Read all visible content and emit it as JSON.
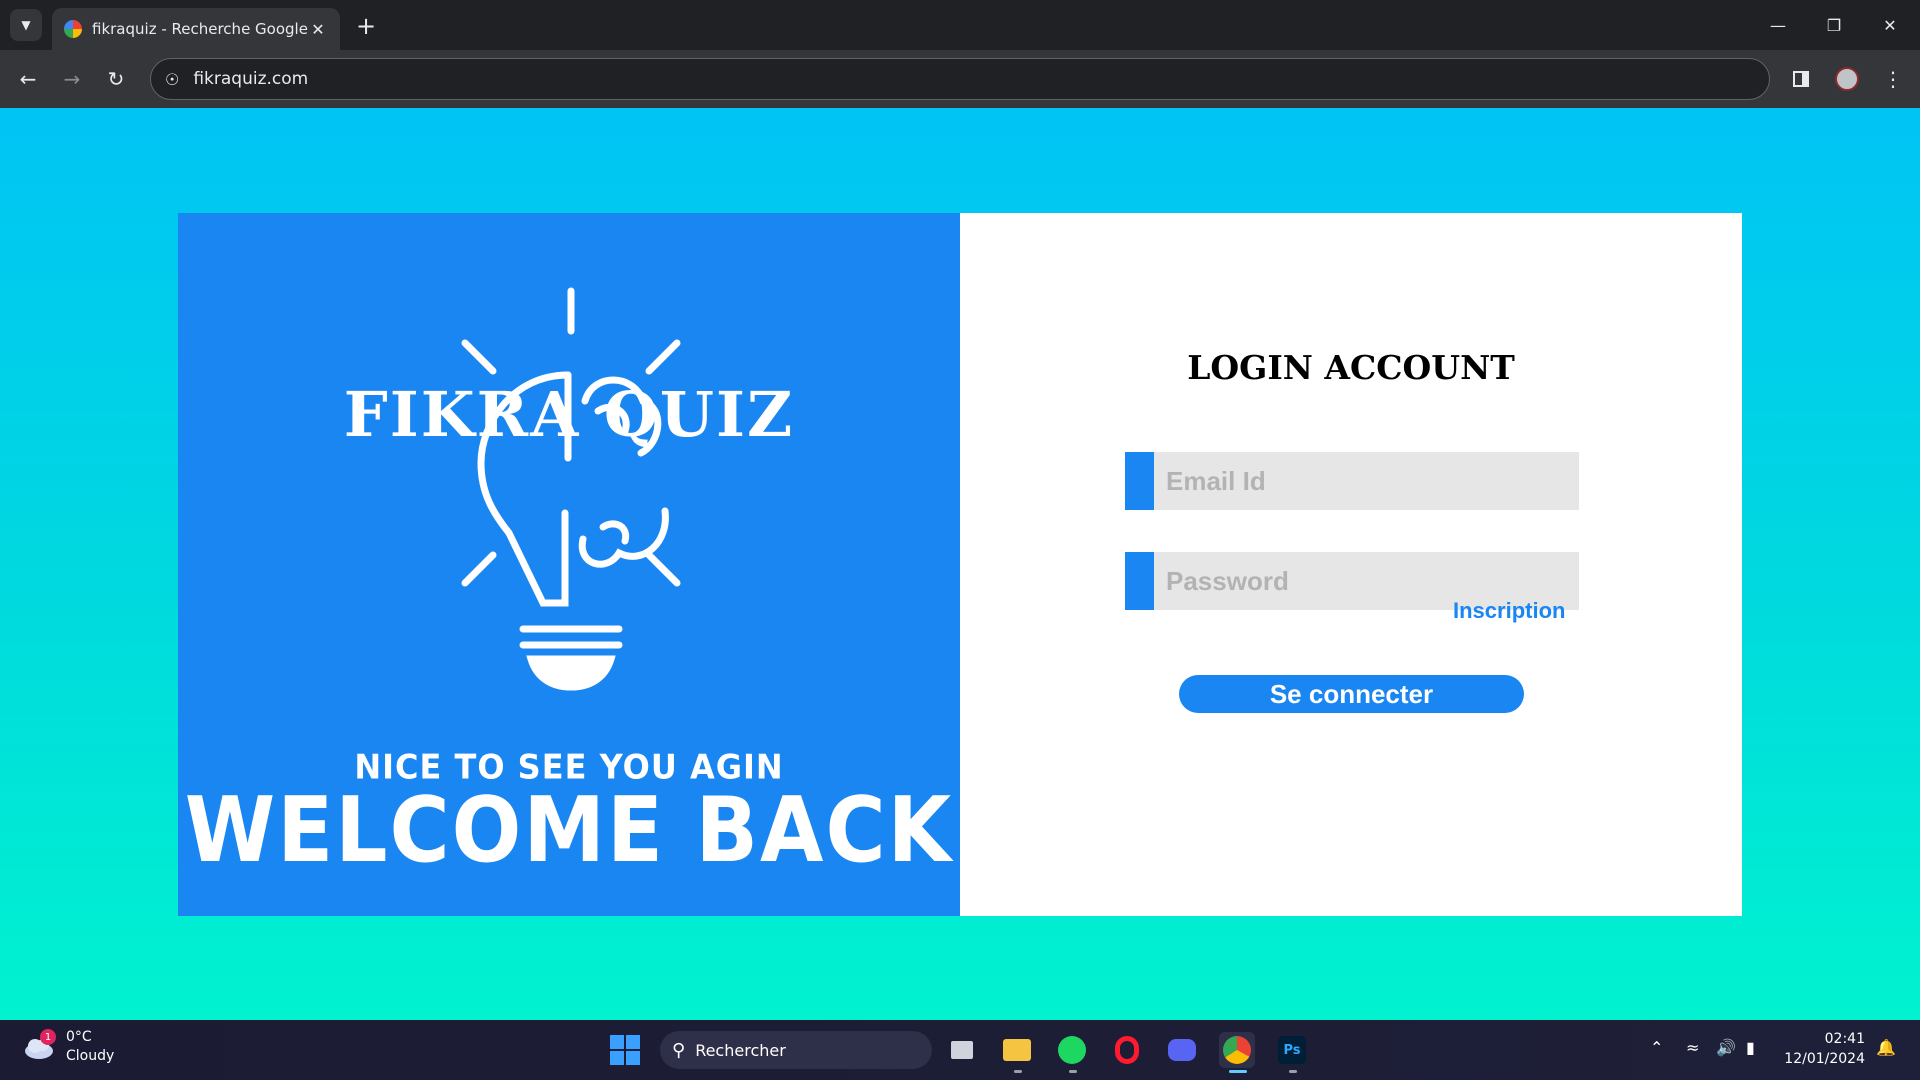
{
  "browser": {
    "tab_title": "fikraquiz - Recherche Google",
    "url": "fikraquiz.com"
  },
  "hero": {
    "brand": "FIKRA QUIZ",
    "tagline": "NICE TO SEE YOU AGIN",
    "headline": "WELCOME BACK"
  },
  "login": {
    "title": "LOGIN ACCOUNT",
    "email_placeholder": "Email Id",
    "password_placeholder": "Password",
    "signup_link": "Inscription",
    "submit_label": "Se connecter"
  },
  "colors": {
    "page_gradient_top": "#00c4f5",
    "page_gradient_bottom": "#00f2cf",
    "accent_blue": "#1a86f2",
    "field_bg": "#e6e6e6"
  },
  "taskbar": {
    "weather_temp": "0°C",
    "weather_desc": "Cloudy",
    "weather_badge": "1",
    "search_label": "Rechercher",
    "time": "02:41",
    "date": "12/01/2024",
    "apps": [
      "file-explorer-icon",
      "spotify-icon",
      "opera-icon",
      "discord-icon",
      "chrome-icon",
      "photoshop-icon"
    ],
    "photoshop_label": "Ps"
  }
}
